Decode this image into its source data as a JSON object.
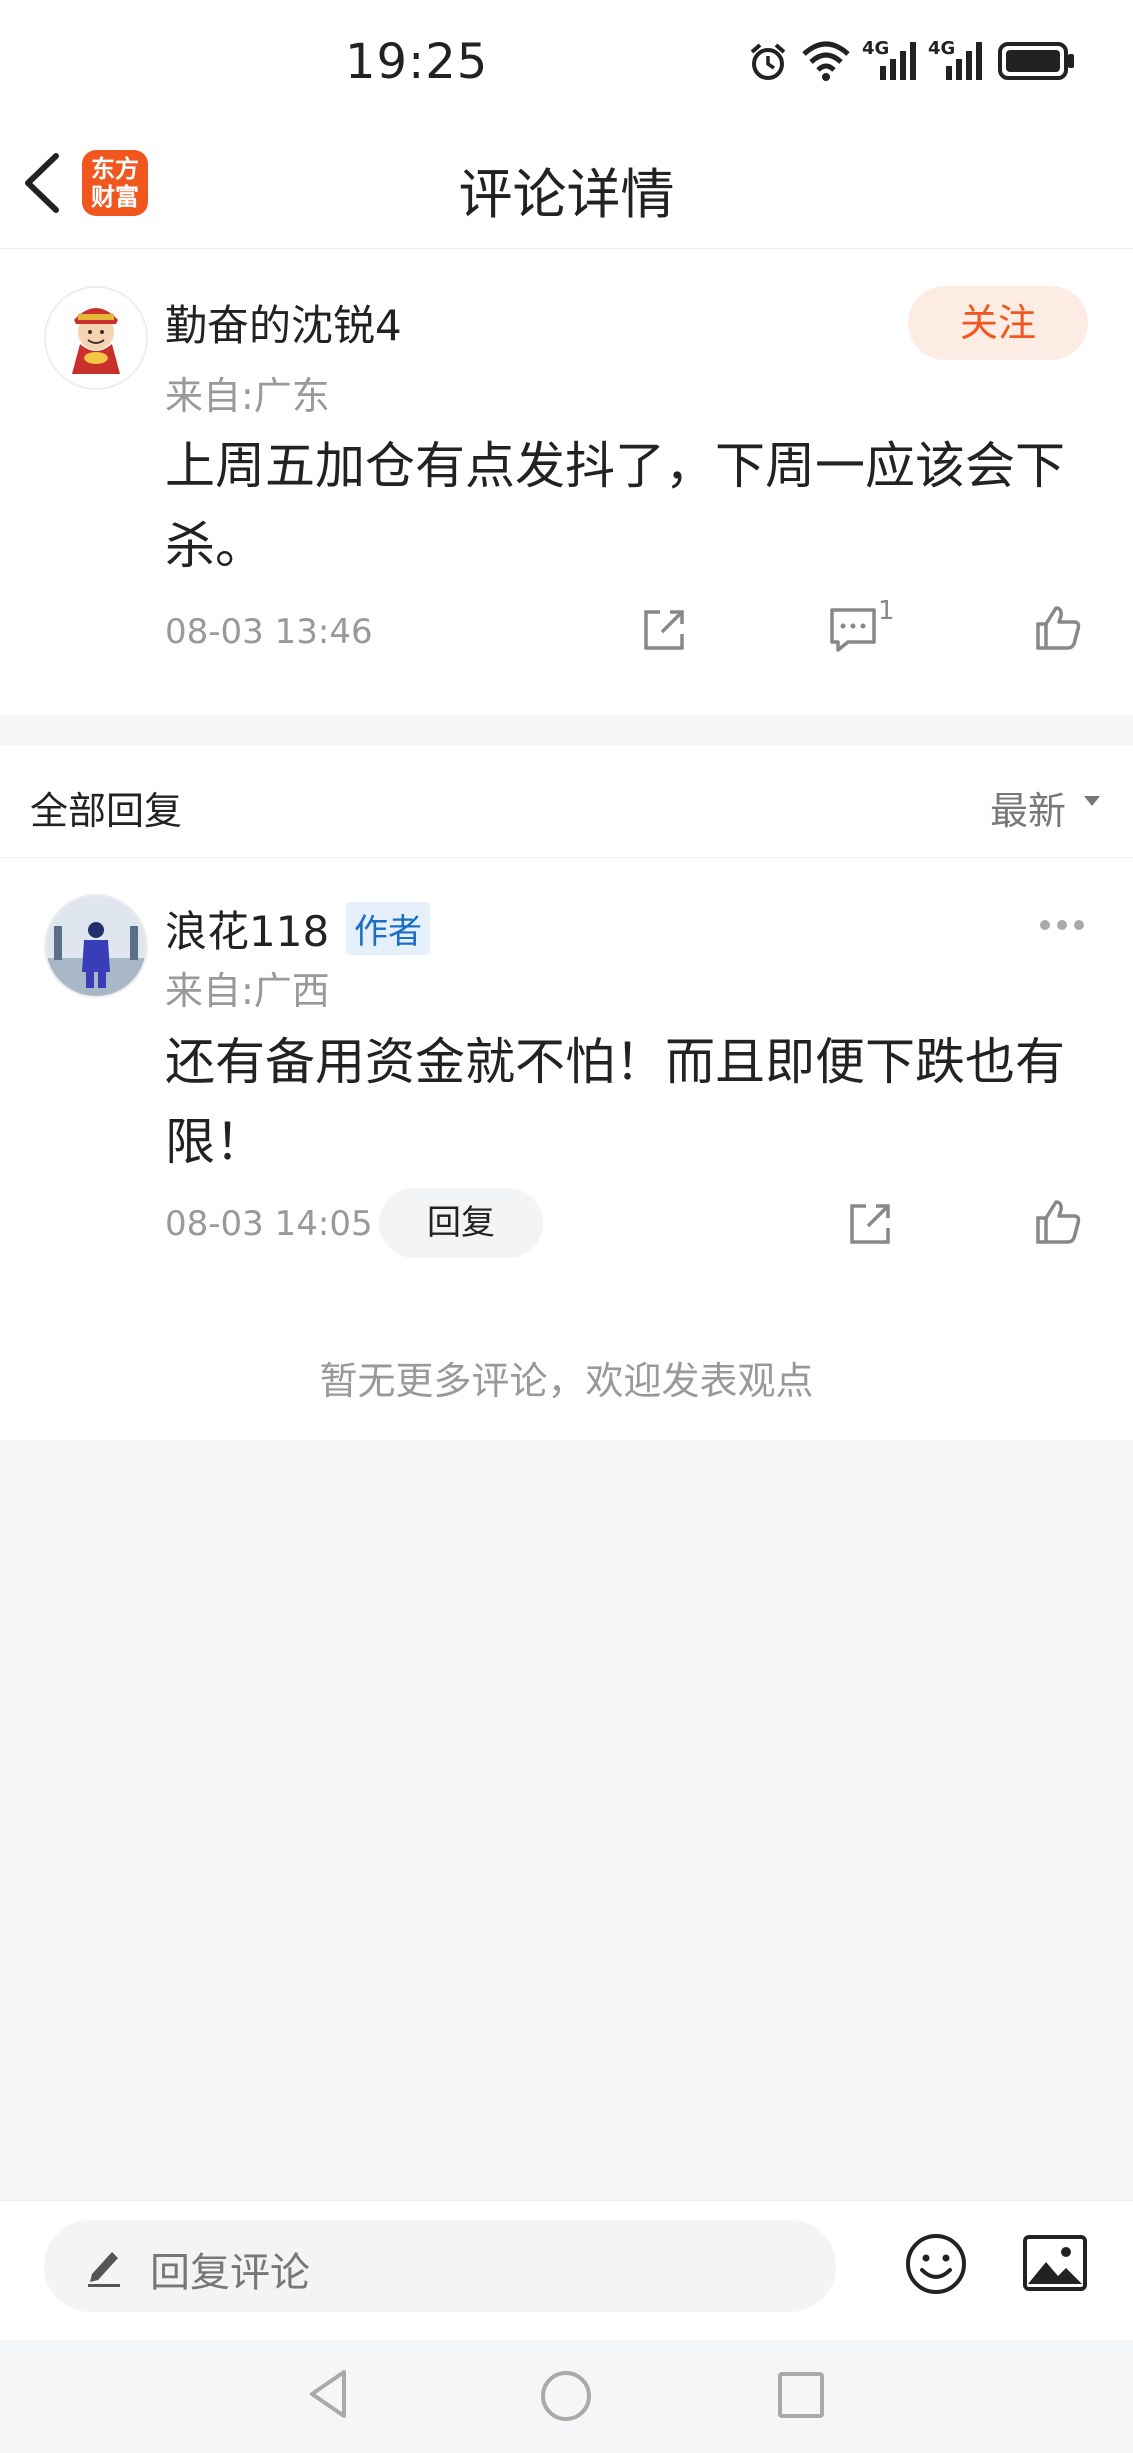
{
  "status_bar": {
    "time": "19:25",
    "signal_1": "4G",
    "signal_2": "4G"
  },
  "nav": {
    "title": "评论详情",
    "logo_text": "东方\n财富"
  },
  "comment": {
    "username": "勤奋的沈锐4",
    "location": "来自:广东",
    "follow_label": "关注",
    "text": "上周五加仓有点发抖了，下周一应该会下杀。",
    "timestamp": "08-03 13:46",
    "reply_count": "1"
  },
  "replies_header": {
    "label": "全部回复",
    "sort_label": "最新"
  },
  "reply": {
    "username": "浪花118",
    "badge": "作者",
    "location": "来自:广西",
    "text": "还有备用资金就不怕！而且即便下跌也有限！",
    "timestamp": "08-03 14:05",
    "reply_button": "回复"
  },
  "no_more_text": "暂无更多评论，欢迎发表观点",
  "bottom_bar": {
    "input_placeholder": "回复评论"
  },
  "colors": {
    "accent": "#f0561d",
    "badge_blue": "#1a6ec5"
  }
}
